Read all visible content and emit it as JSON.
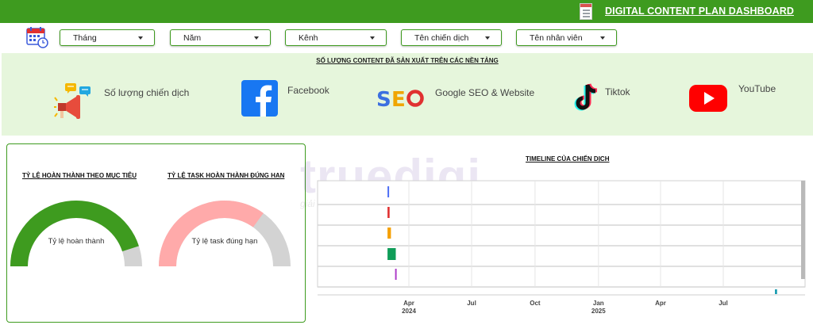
{
  "header": {
    "title": "DIGITAL CONTENT PLAN DASHBOARD",
    "background_color": "#3e9b1f",
    "icon": "spreadsheet-icon"
  },
  "filters": {
    "icon": "calendar-clock-icon",
    "items": [
      {
        "label": "Tháng"
      },
      {
        "label": "Năm"
      },
      {
        "label": "Kênh"
      },
      {
        "label": "Tên chiến dịch"
      },
      {
        "label": "Tên nhân viên"
      }
    ]
  },
  "platforms": {
    "title": "SỐ LƯỢNG CONTENT ĐÃ SẢN XUẤT TRÊN CÁC NỀN TẢNG",
    "background_color": "#e6f6dc",
    "items": [
      {
        "label": "Số lượng chiến dịch",
        "icon": "megaphone-icon"
      },
      {
        "label": "Facebook",
        "icon": "facebook-icon"
      },
      {
        "label": "Google SEO & Website",
        "icon": "seo-icon"
      },
      {
        "label": "Tiktok",
        "icon": "tiktok-icon"
      },
      {
        "label": "YouTube",
        "icon": "youtube-icon"
      }
    ]
  },
  "gauges": [
    {
      "title": "TỶ LỆ HOÀN THÀNH THEO MỤC TIÊU",
      "label": "Tỷ lệ hoàn thành",
      "fraction": 0.9,
      "color": "#3e9b1f",
      "track_color": "#d3d3d3"
    },
    {
      "title": "TỶ LỆ TASK HOÀN THÀNH ĐÚNG HẠN",
      "label": "Tỷ lệ task đúng hạn",
      "fraction": 0.7,
      "color": "#ffaaaa",
      "track_color": "#d3d3d3"
    }
  ],
  "watermark": {
    "text": "truedigi",
    "tagline": "giải pháp thực, thành công thật"
  },
  "timeline": {
    "title": "TIMELINE CỦA CHIẾN DỊCH"
  },
  "chart_data": {
    "type": "bar",
    "title": "TIMELINE CỦA CHIẾN DỊCH",
    "orientation": "horizontal-gantt",
    "x_ticks": [
      {
        "date": "2024-04-01",
        "label": "Apr",
        "year": "2024"
      },
      {
        "date": "2024-07-01",
        "label": "Jul"
      },
      {
        "date": "2024-10-01",
        "label": "Oct"
      },
      {
        "date": "2025-01-01",
        "label": "Jan",
        "year": "2025"
      },
      {
        "date": "2025-04-01",
        "label": "Apr"
      },
      {
        "date": "2025-07-01",
        "label": "Jul"
      }
    ],
    "xlim": [
      "2024-03-01",
      "2025-10-15"
    ],
    "grid": true,
    "tasks": [
      {
        "start": "2024-03-01",
        "end": "2024-03-02",
        "color": "#4c6ef5"
      },
      {
        "start": "2024-03-01",
        "end": "2024-03-04",
        "color": "#e03131"
      },
      {
        "start": "2024-03-01",
        "end": "2024-03-06",
        "color": "#f5a000"
      },
      {
        "start": "2024-03-01",
        "end": "2024-03-13",
        "color": "#0f9d58"
      },
      {
        "start": "2024-03-12",
        "end": "2024-03-13",
        "color": "#ae3ec9"
      },
      {
        "start": "2025-09-14",
        "end": "2025-09-17",
        "color": "#1098ad"
      }
    ]
  }
}
